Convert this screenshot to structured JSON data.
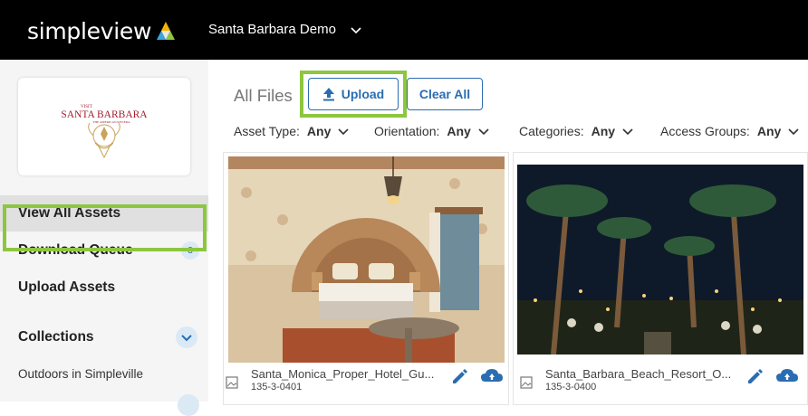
{
  "header": {
    "logo_text": "simpleview",
    "site_name": "Santa Barbara Demo"
  },
  "sidebar": {
    "brand": {
      "line1": "VISIT",
      "line2": "SANTA BARBARA",
      "line3": "THE AMERICAN RIVIERA"
    },
    "items": [
      {
        "label": "View All Assets"
      },
      {
        "label": "Download Queue",
        "badge": "3"
      },
      {
        "label": "Upload Assets"
      },
      {
        "label": "Collections"
      }
    ],
    "sub_items": [
      {
        "label": "Outdoors in Simpleville"
      }
    ]
  },
  "main": {
    "title": "All Files",
    "upload_label": "Upload",
    "clear_label": "Clear All",
    "filters": [
      {
        "label": "Asset Type:",
        "value": "Any"
      },
      {
        "label": "Orientation:",
        "value": "Any"
      },
      {
        "label": "Categories:",
        "value": "Any"
      },
      {
        "label": "Access Groups:",
        "value": "Any"
      }
    ],
    "assets": [
      {
        "name": "Santa_Monica_Proper_Hotel_Gu...",
        "id": "135-3-0401"
      },
      {
        "name": "Santa_Barbara_Beach_Resort_O...",
        "id": "135-3-0400"
      }
    ]
  },
  "colors": {
    "accent": "#2a6db0",
    "highlight": "#8dc63f",
    "topbar": "#000000"
  },
  "icons": [
    "chevron-down-icon",
    "upload-icon",
    "image-icon",
    "pencil-icon",
    "cloud-download-icon"
  ]
}
